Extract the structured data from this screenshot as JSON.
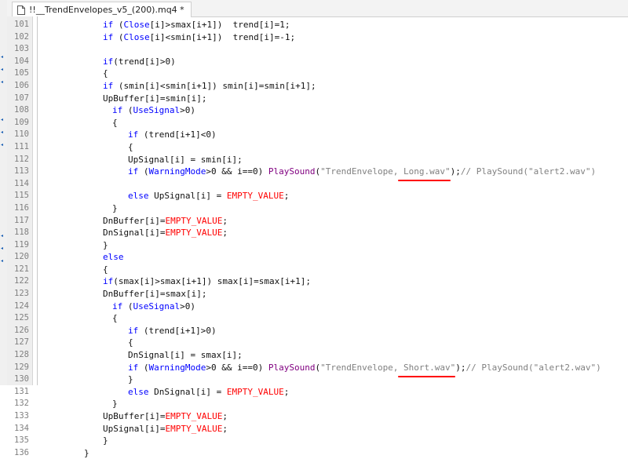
{
  "tab": {
    "title": "!!__TrendEnvelopes_v5_(200).mq4 *"
  },
  "colors": {
    "keyword": "#0000ff",
    "function": "#800080",
    "string": "#808080",
    "constant": "#ff0000",
    "annotation": "#ff0000"
  },
  "lines": [
    {
      "no": "101",
      "text": "if (Close[i]>smax[i+1])  trend[i]=1;"
    },
    {
      "no": "102",
      "text": "if (Close[i]<smin[i+1])  trend[i]=-1;"
    },
    {
      "no": "103",
      "text": ""
    },
    {
      "no": "104",
      "text": "if(trend[i]>0)"
    },
    {
      "no": "105",
      "text": "{"
    },
    {
      "no": "106",
      "text": "if (smin[i]<smin[i+1]) smin[i]=smin[i+1];"
    },
    {
      "no": "107",
      "text": "UpBuffer[i]=smin[i];"
    },
    {
      "no": "108",
      "text": "if (UseSignal>0)"
    },
    {
      "no": "109",
      "text": "{"
    },
    {
      "no": "110",
      "text": "if (trend[i+1]<0)"
    },
    {
      "no": "111",
      "text": "{"
    },
    {
      "no": "112",
      "text": "UpSignal[i] = smin[i];"
    },
    {
      "no": "113",
      "text": "if (WarningMode>0 && i==0) PlaySound(\"TrendEnvelope, Long.wav\");// PlaySound(\"alert2.wav\")"
    },
    {
      "no": "114",
      "text": ""
    },
    {
      "no": "115",
      "text": "else UpSignal[i] = EMPTY_VALUE;"
    },
    {
      "no": "116",
      "text": "}"
    },
    {
      "no": "117",
      "text": "DnBuffer[i]=EMPTY_VALUE;"
    },
    {
      "no": "118",
      "text": "DnSignal[i]=EMPTY_VALUE;"
    },
    {
      "no": "119",
      "text": "}"
    },
    {
      "no": "120",
      "text": "else"
    },
    {
      "no": "121",
      "text": "{"
    },
    {
      "no": "122",
      "text": "if(smax[i]>smax[i+1]) smax[i]=smax[i+1];"
    },
    {
      "no": "123",
      "text": "DnBuffer[i]=smax[i];"
    },
    {
      "no": "124",
      "text": "if (UseSignal>0)"
    },
    {
      "no": "125",
      "text": "{"
    },
    {
      "no": "126",
      "text": "if (trend[i+1]>0)"
    },
    {
      "no": "127",
      "text": "{"
    },
    {
      "no": "128",
      "text": "DnSignal[i] = smax[i];"
    },
    {
      "no": "129",
      "text": "if (WarningMode>0 && i==0) PlaySound(\"TrendEnvelope, Short.wav\");// PlaySound(\"alert2.wav\")"
    },
    {
      "no": "130",
      "text": "}"
    },
    {
      "no": "131",
      "text": "else DnSignal[i] = EMPTY_VALUE;"
    },
    {
      "no": "132",
      "text": "}"
    },
    {
      "no": "133",
      "text": "UpBuffer[i]=EMPTY_VALUE;"
    },
    {
      "no": "134",
      "text": "UpSignal[i]=EMPTY_VALUE;"
    },
    {
      "no": "135",
      "text": "}"
    },
    {
      "no": "136",
      "text": "}"
    }
  ]
}
